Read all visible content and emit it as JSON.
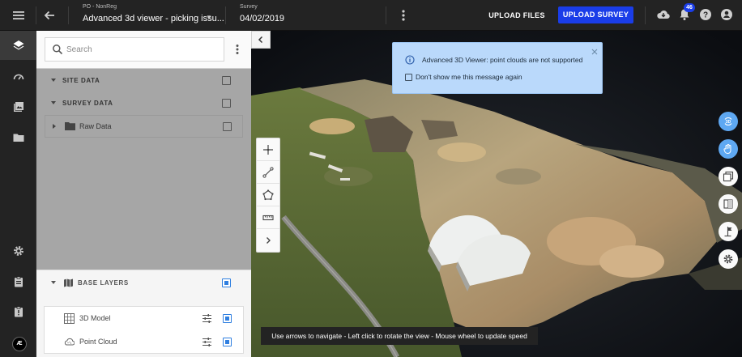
{
  "topbar": {
    "project_label": "PO - NonReg",
    "project_title": "Advanced 3d viewer - picking issu...",
    "survey_label": "Survey",
    "survey_date": "04/02/2019",
    "upload_files": "UPLOAD FILES",
    "upload_survey": "UPLOAD SURVEY",
    "notification_count": "46"
  },
  "rail": {
    "items": [
      "layers-icon",
      "dashboard-icon",
      "photo-library-icon",
      "folder-icon",
      "settings-icon",
      "clipboard-icon",
      "report-icon"
    ],
    "logo_text": "Æ"
  },
  "panel": {
    "search_placeholder": "Search",
    "groups": [
      {
        "label": "SITE DATA",
        "checked": false
      },
      {
        "label": "SURVEY DATA",
        "checked": false
      }
    ],
    "raw_data_label": "Raw Data",
    "base_layers": {
      "label": "BASE LAYERS",
      "items": [
        {
          "label": "3D Model",
          "checked": true
        },
        {
          "label": "Point Cloud",
          "checked": true
        }
      ]
    }
  },
  "viewer": {
    "info_message": "Advanced 3D Viewer: point clouds are not supported",
    "info_checkbox_label": "Don't show me this message again",
    "hint": "Use arrows to navigate - Left click to rotate the view - Mouse wheel to update speed",
    "tools": [
      "crosshair-icon",
      "line-measure-icon",
      "polygon-icon",
      "ruler-icon",
      "expand-chevron-icon"
    ],
    "side_buttons": [
      "3d-view-icon",
      "hand-pan-icon",
      "layers-stack-icon",
      "split-view-icon",
      "map-marker-icon",
      "settings-icon"
    ]
  },
  "colors": {
    "accent": "#1a3de8",
    "info_bg": "#bad9fb",
    "active_side": "#5ea8f2"
  }
}
